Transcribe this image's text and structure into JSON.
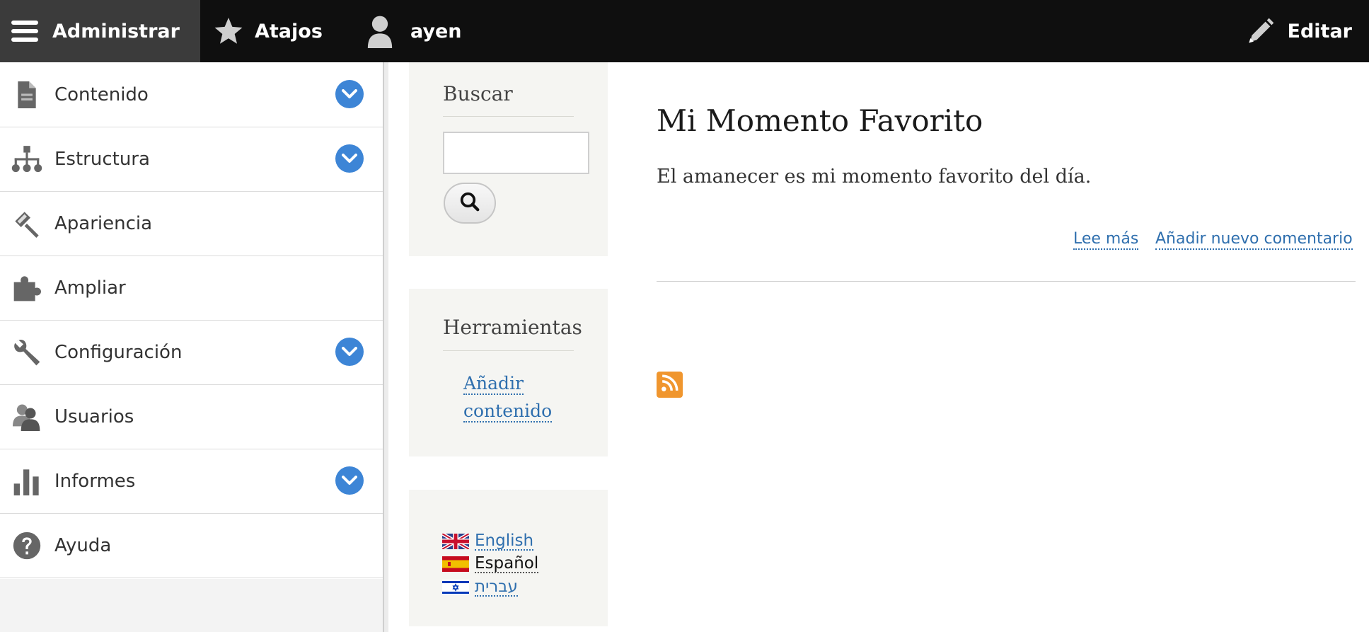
{
  "toolbar": {
    "admin": {
      "label": "Administrar",
      "icon": "hamburger-menu-icon"
    },
    "shortcuts": {
      "label": "Atajos",
      "icon": "star-icon"
    },
    "user": {
      "label": "ayen",
      "icon": "user-icon"
    },
    "edit": {
      "label": "Editar",
      "icon": "pencil-icon"
    }
  },
  "tray": {
    "items": [
      {
        "label": "Contenido",
        "icon": "document-icon",
        "expandable": true
      },
      {
        "label": "Estructura",
        "icon": "sitemap-icon",
        "expandable": true
      },
      {
        "label": "Apariencia",
        "icon": "paintbrush-icon",
        "expandable": false
      },
      {
        "label": "Ampliar",
        "icon": "puzzle-icon",
        "expandable": false
      },
      {
        "label": "Configuración",
        "icon": "wrench-icon",
        "expandable": true
      },
      {
        "label": "Usuarios",
        "icon": "users-icon",
        "expandable": false
      },
      {
        "label": "Informes",
        "icon": "bar-chart-icon",
        "expandable": true
      },
      {
        "label": "Ayuda",
        "icon": "help-icon",
        "expandable": false
      }
    ]
  },
  "search_block": {
    "title": "Buscar",
    "input_value": "",
    "button_icon": "magnifier-icon"
  },
  "tools_block": {
    "title": "Herramientas",
    "link_line1": "Añadir",
    "link_line2": "contenido"
  },
  "language_block": {
    "languages": [
      {
        "label": "English",
        "flag": "uk-flag-icon",
        "current": false
      },
      {
        "label": "Español",
        "flag": "spain-flag-icon",
        "current": true
      },
      {
        "label": "עברית",
        "flag": "israel-flag-icon",
        "current": false
      }
    ]
  },
  "node": {
    "title": "Mi Momento Favorito",
    "body": "El amanecer es mi momento favorito del día.",
    "read_more": "Lee más",
    "add_comment": "Añadir nuevo comentario"
  },
  "feed": {
    "icon": "rss-icon"
  },
  "colors": {
    "toolbar_bg": "#0f0f0f",
    "toggle_blue": "#3d85d6",
    "link_blue": "#2f6fae",
    "rss_orange": "#f0962e",
    "block_bg": "#f5f5f2"
  }
}
